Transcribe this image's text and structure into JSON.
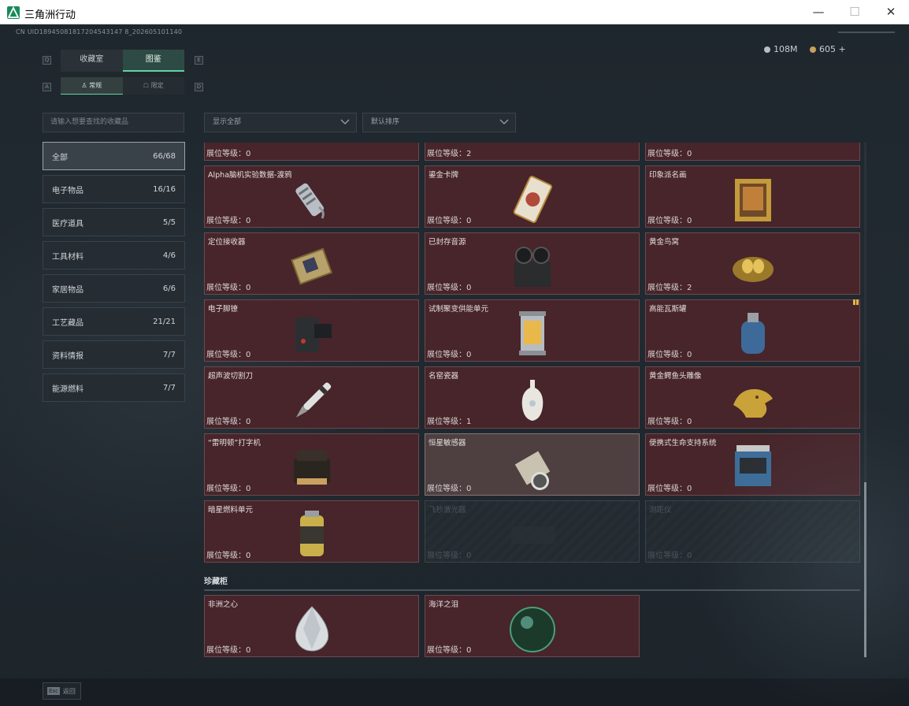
{
  "window": {
    "title": "三角洲行动",
    "minimize": "—",
    "maximize": "☐",
    "close": "✕"
  },
  "header": {
    "uid": "CN UID18945081817204543147 8_202605101140",
    "currency": [
      {
        "value": "108M",
        "color": "#b8bec3"
      },
      {
        "value": "605 +",
        "color": "#c9a05a"
      }
    ]
  },
  "key_hints": {
    "tab_left": "Q",
    "tab_right": "E",
    "sub_left": "A",
    "sub_right": "D"
  },
  "tabs": [
    {
      "label": "收藏室",
      "active": false
    },
    {
      "label": "图鉴",
      "active": true
    }
  ],
  "subtabs": [
    {
      "label": "常规",
      "active": true
    },
    {
      "label": "限定",
      "active": false
    }
  ],
  "search": {
    "placeholder": "请输入想要查找的收藏品"
  },
  "categories": [
    {
      "label": "全部",
      "count": "66/68",
      "active": true
    },
    {
      "label": "电子物品",
      "count": "16/16"
    },
    {
      "label": "医疗道具",
      "count": "5/5"
    },
    {
      "label": "工具材料",
      "count": "4/6"
    },
    {
      "label": "家居物品",
      "count": "6/6"
    },
    {
      "label": "工艺藏品",
      "count": "21/21"
    },
    {
      "label": "资料情报",
      "count": "7/7"
    },
    {
      "label": "能源燃料",
      "count": "7/7"
    }
  ],
  "filters": {
    "show": "显示全部",
    "sort": "默认排序"
  },
  "level_label": "展位等级：",
  "items": [
    {
      "name": "",
      "level": "0",
      "icon": "gold-disc-icon"
    },
    {
      "name": "",
      "level": "2",
      "icon": "chain-icon"
    },
    {
      "name": "",
      "level": "0",
      "icon": "white-object-icon"
    },
    {
      "name": "Alpha脑机实验数据-渡鸦",
      "level": "0",
      "icon": "data-drive-icon"
    },
    {
      "name": "鎏金卡牌",
      "level": "0",
      "icon": "gilded-card-icon"
    },
    {
      "name": "印象派名画",
      "level": "0",
      "icon": "framed-painting-icon"
    },
    {
      "name": "定位接收器",
      "level": "0",
      "icon": "gps-receiver-icon"
    },
    {
      "name": "已封存音源",
      "level": "0",
      "icon": "reel-recorder-icon"
    },
    {
      "name": "黄金鸟窝",
      "level": "2",
      "icon": "golden-nest-icon"
    },
    {
      "name": "电子脚镣",
      "level": "0",
      "icon": "ankle-monitor-icon"
    },
    {
      "name": "试制聚变供能单元",
      "level": "0",
      "icon": "fusion-unit-icon"
    },
    {
      "name": "高能瓦斯罐",
      "level": "0",
      "icon": "gas-tank-icon"
    },
    {
      "name": "超声波切割刀",
      "level": "0",
      "icon": "ultrasonic-cutter-icon"
    },
    {
      "name": "名窑瓷器",
      "level": "1",
      "icon": "porcelain-vase-icon"
    },
    {
      "name": "黄金鳄鱼头雕像",
      "level": "0",
      "icon": "gold-crocodile-icon"
    },
    {
      "name": "“雷明顿”打字机",
      "level": "0",
      "icon": "typewriter-icon"
    },
    {
      "name": "恒星敏感器",
      "level": "0",
      "icon": "star-sensor-icon",
      "hover": true
    },
    {
      "name": "便携式生命支持系统",
      "level": "0",
      "icon": "life-support-icon"
    },
    {
      "name": "暗星燃料单元",
      "level": "0",
      "icon": "fuel-cell-icon"
    },
    {
      "name": "飞秒激光器",
      "level": "0",
      "icon": "laser-icon",
      "locked": true
    },
    {
      "name": "测距仪",
      "level": "0",
      "icon": "rangefinder-icon",
      "locked": true
    }
  ],
  "section": {
    "title": "珍藏柜"
  },
  "special_items": [
    {
      "name": "非洲之心",
      "level": "0",
      "icon": "diamond-icon"
    },
    {
      "name": "海洋之泪",
      "level": "0",
      "icon": "ocean-orb-icon"
    }
  ],
  "footer": {
    "key": "Esc",
    "label": "返回"
  }
}
